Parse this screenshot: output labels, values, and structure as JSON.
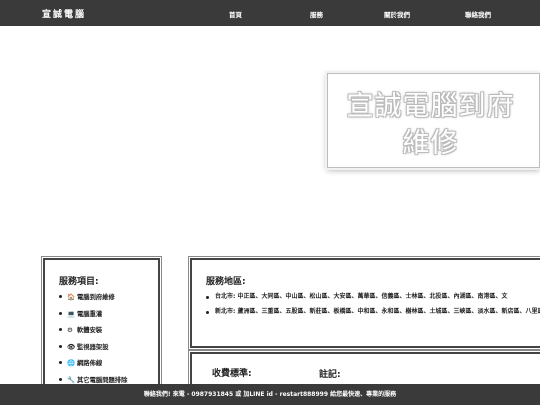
{
  "header": {
    "brand": "宣誠電腦",
    "nav": [
      "首頁",
      "服務",
      "關於我們",
      "聯絡我們"
    ]
  },
  "hero": {
    "line1": "宣誠電腦到府",
    "line2": "維修"
  },
  "services": {
    "title": "服務項目:",
    "items": [
      {
        "icon": "house-icon",
        "glyph": "🏠",
        "label": "電腦到府維修"
      },
      {
        "icon": "computer-icon",
        "glyph": "💻",
        "label": "電腦重灌"
      },
      {
        "icon": "gear-icon",
        "glyph": "⚙",
        "label": "軟體安裝"
      },
      {
        "icon": "eye-icon",
        "glyph": "👁",
        "label": "監視器架設"
      },
      {
        "icon": "globe-icon",
        "glyph": "🌐",
        "label": "網路佈線"
      },
      {
        "icon": "tools-icon",
        "glyph": "🔧",
        "label": "其它電腦問題排除"
      }
    ]
  },
  "areas": {
    "title": "服務地區:",
    "items": [
      "台北市: 中正區、大同區、中山區、松山區、大安區、萬華區、信義區、士林區、北投區、內湖區、南港區、文",
      "新北市: 蘆洲區、三重區、五股區、新莊區、板橋區、中和區、永和區、樹林區、土城區、三峽區、淡水區、新店區、八里區"
    ]
  },
  "fees": {
    "title": "收費標準:",
    "note_title": "註記:"
  },
  "footer": {
    "text": "聯絡我們! 來電 - 0987931845 或 加LINE id - restart888999 給您最快速、專業的服務"
  },
  "colors": {
    "bar": "#3a3a3a",
    "text": "#222222",
    "border": "#444444"
  }
}
